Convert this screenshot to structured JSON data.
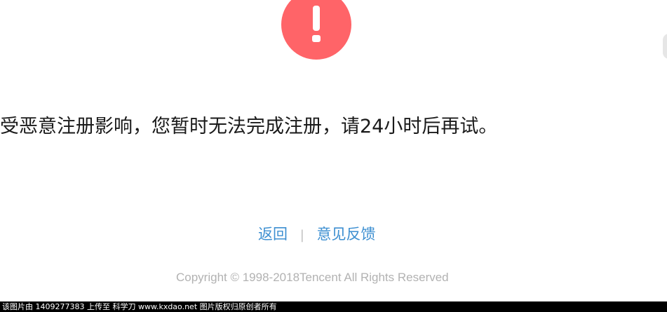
{
  "alert": {
    "icon": "exclamation-icon",
    "glyph": "!",
    "color": "#ff6468"
  },
  "message": "受恶意注册影响，您暂时无法完成注册，请24小时后再试。",
  "links": {
    "back_label": "返回",
    "separator": "|",
    "feedback_label": "意见反馈",
    "color": "#3d8fd1"
  },
  "footer": {
    "copyright": "Copyright © 1998-2018Tencent All Rights Reserved"
  },
  "watermark": {
    "text": "该图片由 1409277383 上传至 科学刀 www.kxdao.net 图片版权归原创者所有"
  }
}
